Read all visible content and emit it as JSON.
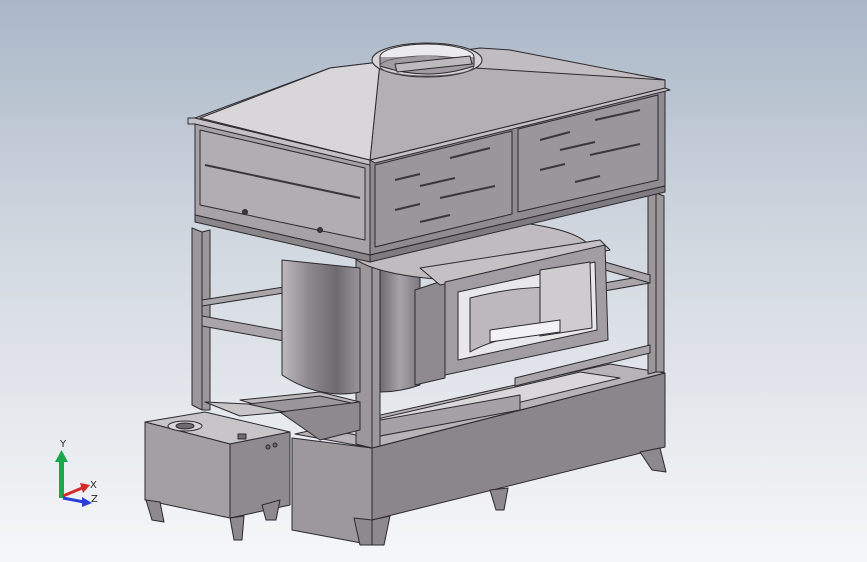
{
  "viewport": {
    "background_top": "#aab7c7",
    "background_bottom": "#f6f7f9"
  },
  "model": {
    "steel_color": "#a39fa3",
    "steel_dark": "#7c777d",
    "steel_light": "#c9c6ca",
    "outline_color": "#2c2a2e"
  },
  "triad": {
    "y_label": "Y",
    "x_label": "X",
    "z_label": "Z",
    "y_color": "#1aa84a",
    "x_color": "#d42a2a",
    "z_color": "#2a3fd4"
  }
}
